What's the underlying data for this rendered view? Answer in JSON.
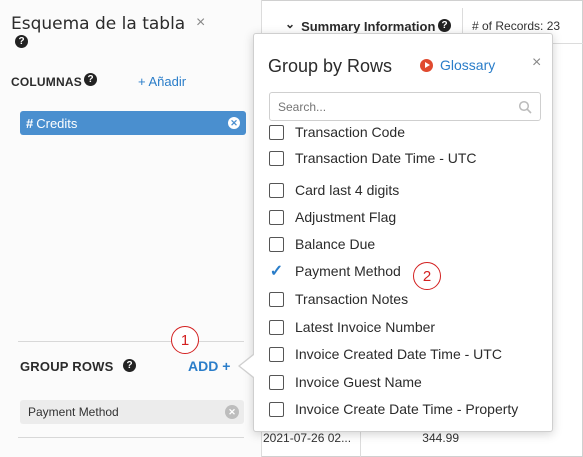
{
  "left_panel": {
    "title": "Esquema de la tabla",
    "close_glyph": "×",
    "help_glyph": "?",
    "columns_label": "COLUMNAS",
    "columns_add": "+ Añadir",
    "credit_hash": "#",
    "credit_label": "Credits",
    "remove_glyph": "✕",
    "group_rows_label": "GROUP ROWS",
    "group_rows_add": "ADD +",
    "grouped_item": "Payment Method"
  },
  "header": {
    "chevron": "⌄",
    "summary": "Summary Information",
    "records": "# of Records: 23"
  },
  "table": {
    "date": "2021-07-26 02...",
    "amount": "344.99"
  },
  "popover": {
    "title": "Group by Rows",
    "glossary": "Glossary",
    "close_glyph": "×",
    "search_placeholder": "Search...",
    "options": [
      {
        "label": "Transaction Code",
        "checked": false
      },
      {
        "label": "Transaction Date Time - UTC",
        "checked": false
      },
      {
        "label": "Card last 4 digits",
        "checked": false
      },
      {
        "label": "Adjustment Flag",
        "checked": false
      },
      {
        "label": "Balance Due",
        "checked": false
      },
      {
        "label": "Payment Method",
        "checked": true
      },
      {
        "label": "Transaction Notes",
        "checked": false
      },
      {
        "label": "Latest Invoice Number",
        "checked": false
      },
      {
        "label": "Invoice Created Date Time - UTC",
        "checked": false
      },
      {
        "label": "Invoice Guest Name",
        "checked": false
      },
      {
        "label": "Invoice Create Date Time - Property",
        "checked": false
      }
    ],
    "check_glyph": "✓"
  },
  "callouts": {
    "one": "1",
    "two": "2"
  },
  "colors": {
    "accent": "#2a7dc9",
    "pill": "#4a8fcf",
    "callout": "#d32020",
    "glossary_icon": "#e04a2f"
  }
}
